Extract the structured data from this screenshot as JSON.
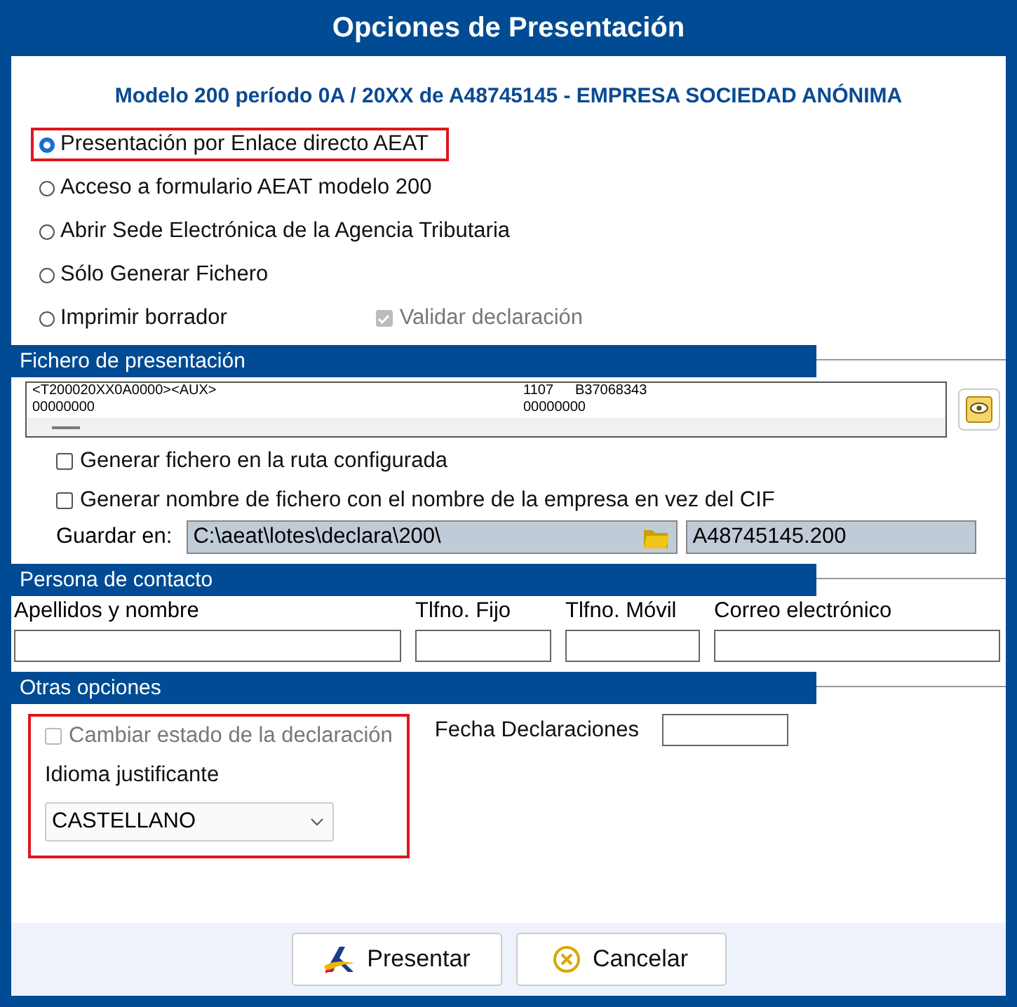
{
  "window": {
    "title": "Opciones de Presentación"
  },
  "subtitle": "Modelo 200 período 0A / 20XX de A48745145 - EMPRESA SOCIEDAD ANÓNIMA",
  "options": [
    {
      "label": "Presentación por Enlace directo AEAT",
      "selected": true,
      "highlighted": true
    },
    {
      "label": "Acceso a formulario AEAT modelo 200",
      "selected": false,
      "highlighted": false
    },
    {
      "label": "Abrir Sede Electrónica de la Agencia Tributaria",
      "selected": false,
      "highlighted": false
    },
    {
      "label": "Sólo Generar Fichero",
      "selected": false,
      "highlighted": false
    },
    {
      "label": "Imprimir borrador",
      "selected": false,
      "highlighted": false
    }
  ],
  "validate": {
    "label": "Validar declaración",
    "checked": true,
    "disabled": true
  },
  "file_section": {
    "title": "Fichero de presentación",
    "preview": [
      [
        "<T200020XX0A0000><AUX>",
        "1107",
        "B37068343"
      ],
      [
        "00000000",
        "00000000"
      ]
    ],
    "checkboxes": [
      {
        "label": "Generar fichero en la ruta configurada",
        "checked": false
      },
      {
        "label": "Generar nombre de fichero con el nombre de la empresa en vez del CIF",
        "checked": false
      }
    ],
    "save_label": "Guardar en:",
    "path": "C:\\aeat\\lotes\\declara\\200\\",
    "filename": "A48745145.200"
  },
  "contact_section": {
    "title": "Persona de contacto",
    "fields": [
      {
        "label": "Apellidos y nombre"
      },
      {
        "label": "Tlfno. Fijo"
      },
      {
        "label": "Tlfno. Móvil"
      },
      {
        "label": "Correo electrónico"
      }
    ]
  },
  "other_section": {
    "title": "Otras opciones",
    "highlighted": true,
    "change_state": {
      "label": "Cambiar estado de la declaración",
      "checked": false,
      "disabled": true
    },
    "language_label": "Idioma justificante",
    "language": "CASTELLANO",
    "date_label": "Fecha Declaraciones"
  },
  "buttons": [
    {
      "label": "Presentar",
      "kind": "submit"
    },
    {
      "label": "Cancelar",
      "kind": "cancel"
    }
  ]
}
